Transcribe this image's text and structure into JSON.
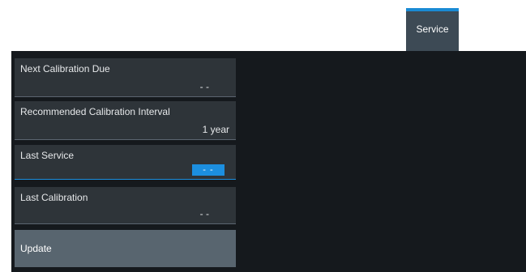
{
  "tabs": [
    {
      "label": "Service",
      "active": true
    }
  ],
  "colors": {
    "accent": "#1c8fe0",
    "panel_background": "#15191d",
    "field_background": "#2e3439",
    "button_background": "#58656f"
  },
  "fields": [
    {
      "label": "Next Calibration Due",
      "value": "- -"
    },
    {
      "label": "Recommended Calibration Interval",
      "value": "1 year"
    },
    {
      "label": "Last Service",
      "value": "- -",
      "focused": true
    },
    {
      "label": "Last Calibration",
      "value": "- -"
    }
  ],
  "update_button": {
    "label": "Update"
  }
}
